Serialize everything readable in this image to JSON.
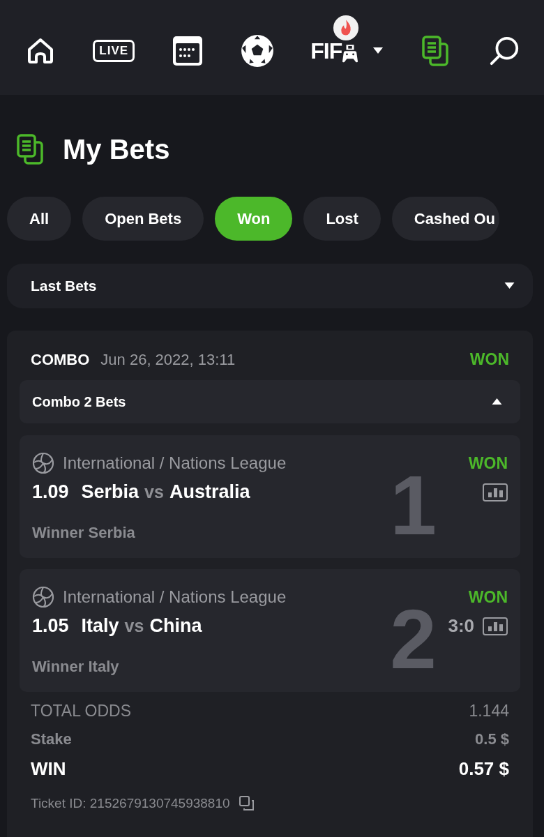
{
  "nav": [
    {
      "kind": "home",
      "selected": false
    },
    {
      "kind": "live",
      "label": "LIVE",
      "selected": false
    },
    {
      "kind": "calendar",
      "selected": false
    },
    {
      "kind": "ball",
      "selected": false
    },
    {
      "kind": "game",
      "label": "FIF",
      "hot": true,
      "selected": false
    },
    {
      "kind": "bets",
      "selected": true
    },
    {
      "kind": "search",
      "selected": false
    }
  ],
  "title": "My Bets",
  "tabs": [
    {
      "label": "All",
      "selected": false
    },
    {
      "label": "Open Bets",
      "selected": false
    },
    {
      "label": "Won",
      "selected": true
    },
    {
      "label": "Lost",
      "selected": false
    },
    {
      "label": "Cashed Ou",
      "selected": false
    }
  ],
  "filter": {
    "value": "Last Bets"
  },
  "bet": {
    "type": "COMBO",
    "date": "Jun 26, 2022, 13:11",
    "status": "WON",
    "group": {
      "label": "Combo 2 Bets",
      "expanded": true
    },
    "selections": [
      {
        "number": "1",
        "league": "International / Nations League",
        "status": "WON",
        "odds": "1.09",
        "home": "Serbia",
        "vs": "vs",
        "away": "Australia",
        "pick": "Winner Serbia"
      },
      {
        "number": "2",
        "league": "International / Nations League",
        "status": "WON",
        "odds": "1.05",
        "home": "Italy",
        "vs": "vs",
        "away": "China",
        "score": "3:0",
        "pick": "Winner Italy"
      }
    ],
    "total_odds": {
      "label": "TOTAL ODDS",
      "value": "1.144"
    },
    "stake": {
      "label": "Stake",
      "value": "0.5 $"
    },
    "win": {
      "label": "WIN",
      "value": "0.57 $"
    },
    "ticket": "Ticket ID: 2152679130745938810"
  }
}
